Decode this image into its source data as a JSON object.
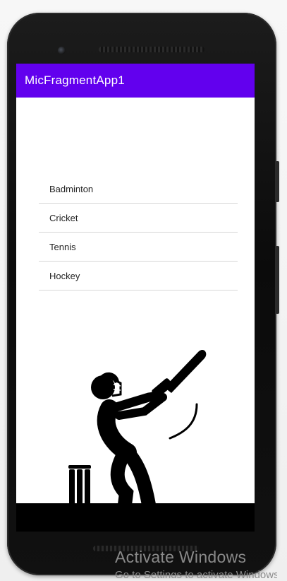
{
  "app": {
    "title": "MicFragmentApp1",
    "accent_color": "#6200ee"
  },
  "sports_list": {
    "items": [
      "Badminton",
      "Cricket",
      "Tennis",
      "Hockey"
    ]
  },
  "illustration": {
    "icon": "cricket-batsman-icon"
  },
  "windows_watermark": {
    "line1": "Activate Windows",
    "line2": "Go to Settings to activate Windows."
  }
}
